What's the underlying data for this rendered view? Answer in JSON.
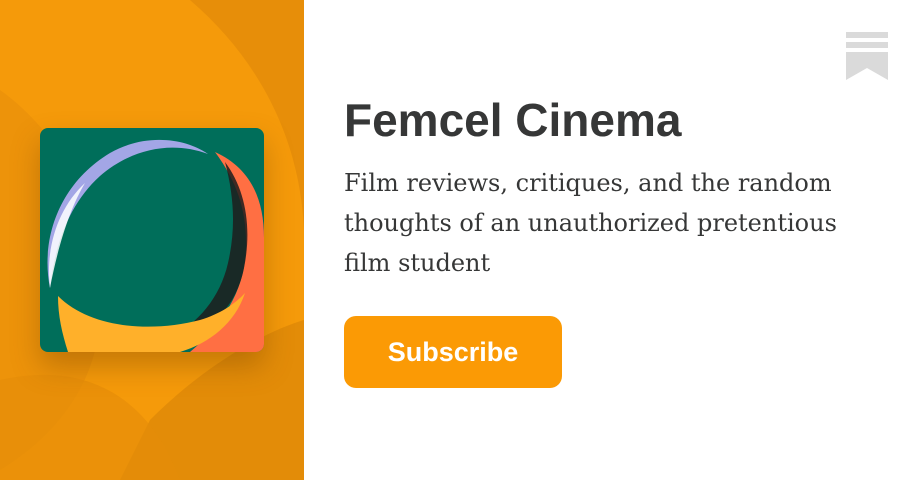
{
  "publication": {
    "name": "Femcel Cinema",
    "description": "Film reviews, critiques, and the random thoughts of an unauthorized pretentious film student"
  },
  "actions": {
    "subscribe_label": "Subscribe"
  },
  "icons": {
    "bookmark": "substack-bookmark-icon"
  },
  "colors": {
    "accent": "#fb9a05",
    "panel_background": "#f59a0a",
    "logo_green": "#006e5a",
    "logo_lavender": "#a3a6e6",
    "logo_coral": "#ff6f43",
    "logo_yellow": "#ffb02a",
    "text": "#363737",
    "bookmark": "#dadada"
  }
}
